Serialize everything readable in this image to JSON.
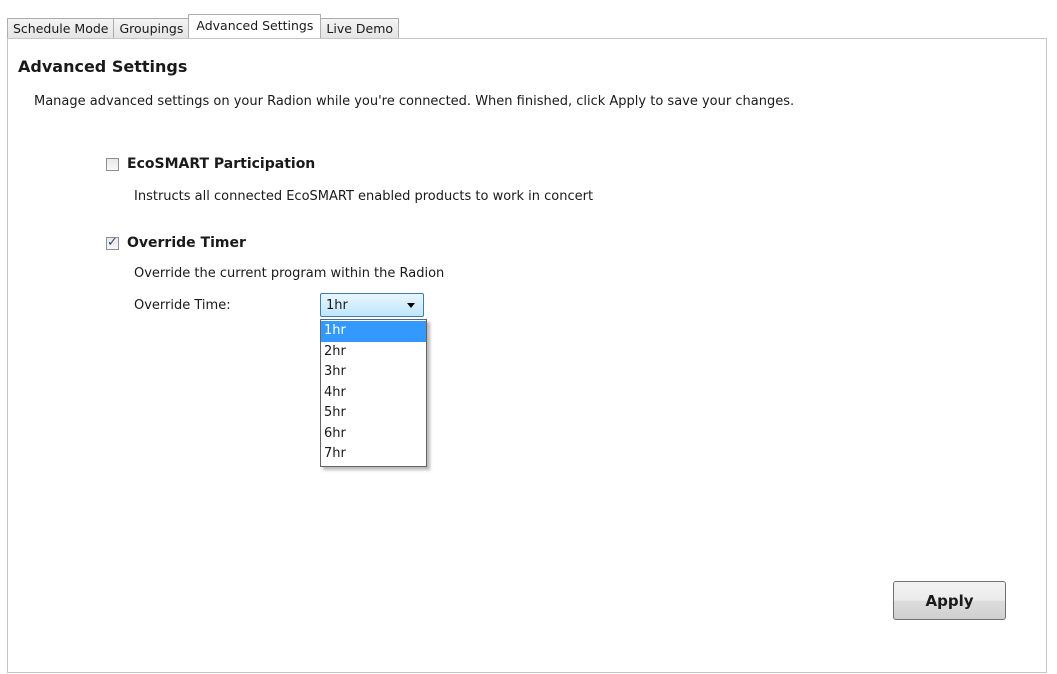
{
  "tabs": [
    {
      "label": "Schedule Mode",
      "active": false
    },
    {
      "label": "Groupings",
      "active": false
    },
    {
      "label": "Advanced Settings",
      "active": true
    },
    {
      "label": "Live Demo",
      "active": false
    }
  ],
  "panel": {
    "title": "Advanced Settings",
    "intro": "Manage advanced settings on your Radion while you're connected.  When finished, click Apply to save your changes."
  },
  "ecosmart": {
    "label": "EcoSMART Participation",
    "checked": false,
    "description": "Instructs all connected EcoSMART enabled products to work in concert"
  },
  "override": {
    "label": "Override Timer",
    "checked": true,
    "description": "Override the current program within the Radion",
    "time_label": "Override Time:",
    "selected": "1hr",
    "options": [
      "1hr",
      "2hr",
      "3hr",
      "4hr",
      "5hr",
      "6hr",
      "7hr"
    ]
  },
  "apply_label": "Apply",
  "colors": {
    "selection_highlight": "#3399ff",
    "checkmark": "#2c4b7a"
  }
}
